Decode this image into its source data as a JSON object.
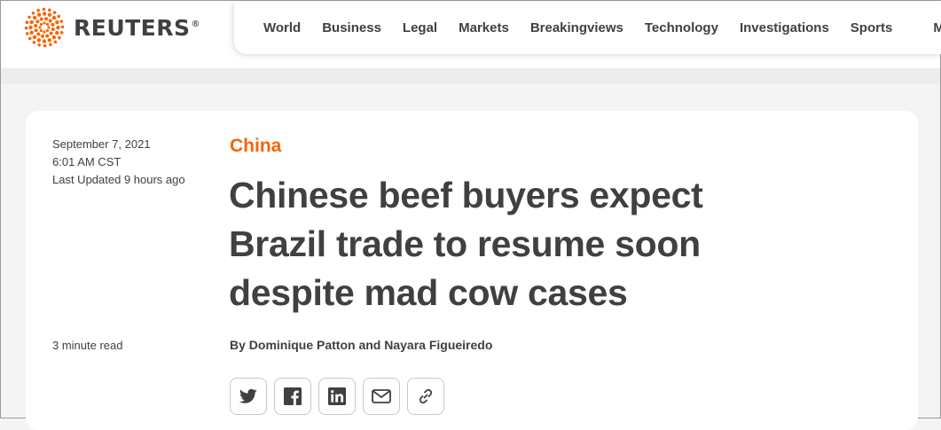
{
  "header": {
    "brand": "REUTERS",
    "brand_mark": "®",
    "nav": [
      "World",
      "Business",
      "Legal",
      "Markets",
      "Breakingviews",
      "Technology",
      "Investigations",
      "Sports"
    ],
    "more": "More"
  },
  "article": {
    "date": "September 7, 2021",
    "time": "6:01 AM CST",
    "updated": "Last Updated 9 hours ago",
    "read_time": "3 minute read",
    "kicker": "China",
    "headline": "Chinese beef buyers expect Brazil trade to resume soon despite mad cow cases",
    "byline": "By Dominique Patton and Nayara Figueiredo"
  },
  "share_icons": [
    "twitter-icon",
    "facebook-icon",
    "linkedin-icon",
    "email-icon",
    "link-icon"
  ],
  "colors": {
    "accent": "#fa6400",
    "text": "#404040"
  }
}
